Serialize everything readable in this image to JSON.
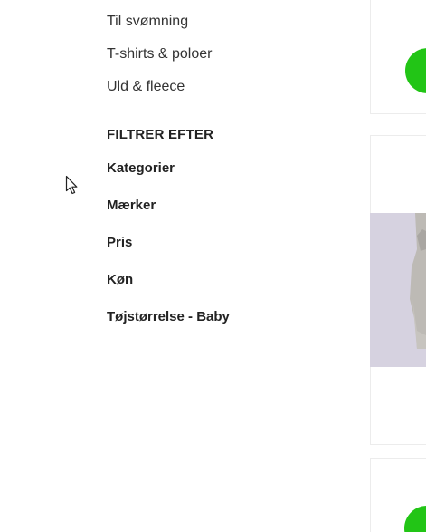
{
  "categories": {
    "items": [
      {
        "label": "Til svømning"
      },
      {
        "label": "T-shirts & poloer"
      },
      {
        "label": "Uld & fleece"
      }
    ]
  },
  "filters": {
    "heading": "FILTRER EFTER",
    "items": [
      {
        "label": "Kategorier"
      },
      {
        "label": "Mærker"
      },
      {
        "label": "Pris"
      },
      {
        "label": "Køn"
      },
      {
        "label": "Tøjstørrelse - Baby"
      }
    ]
  },
  "colors": {
    "accent_green": "#22c516",
    "text": "#333333",
    "heading": "#222222",
    "image_bg": "#d6d2e0"
  },
  "icons": {
    "cursor": "mouse-pointer-icon",
    "add_to_cart": "add-to-cart-button"
  }
}
